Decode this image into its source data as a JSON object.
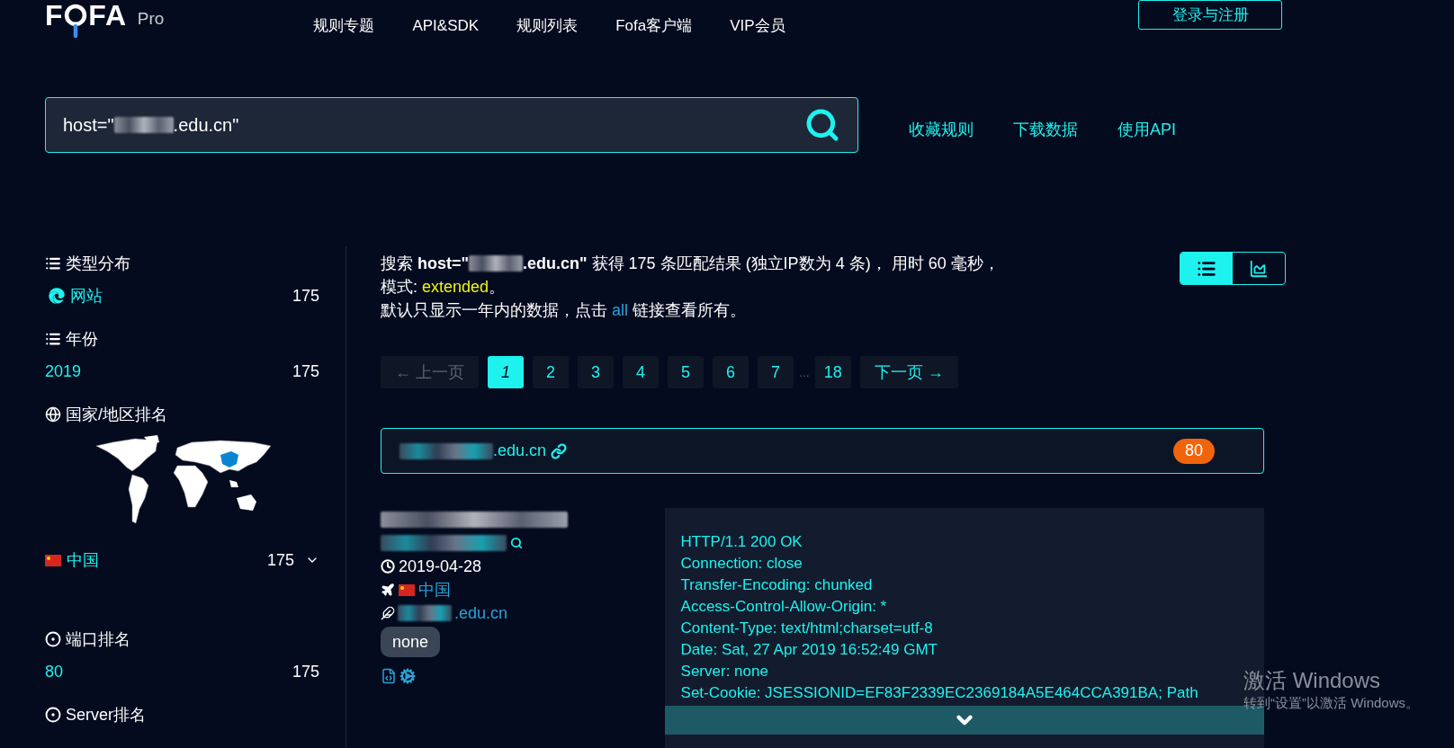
{
  "logo": {
    "letter_start": "F",
    "letter_end": "FA",
    "suffix": "Pro"
  },
  "nav": [
    {
      "label": "规则专题"
    },
    {
      "label": "API&SDK"
    },
    {
      "label": "规则列表"
    },
    {
      "label": "Fofa客户端"
    },
    {
      "label": "VIP会员"
    }
  ],
  "login_button": "登录与注册",
  "search": {
    "value_start": "host=\"",
    "value_end": ".edu.cn\""
  },
  "search_links": [
    "收藏规则",
    "下载数据",
    "使用API"
  ],
  "sidebar": [
    {
      "kind": "category",
      "title": "类型分布",
      "items": [
        {
          "label": "网站",
          "count": "175"
        }
      ]
    },
    {
      "kind": "year",
      "title": "年份",
      "items": [
        {
          "label": "2019",
          "count": "175"
        }
      ]
    },
    {
      "kind": "country",
      "title": "国家/地区排名",
      "items": [
        {
          "label": "中国",
          "count": "175",
          "expanded": false
        }
      ]
    },
    {
      "kind": "port",
      "title": "端口排名",
      "items": [
        {
          "label": "80",
          "count": "175"
        }
      ]
    },
    {
      "kind": "server",
      "title": "Server排名"
    }
  ],
  "summary": {
    "label": "搜索",
    "query_start": "host=\"",
    "query_end": ".edu.cn\"",
    "result": "获得 175 条匹配结果 (独立IP数为 4 条)， 用时 60 毫秒，",
    "mode_label": "模式:",
    "mode": "extended",
    "mode_end": "。",
    "notice_before": "默认只显示一年内的数据，点击",
    "notice_link": "all",
    "notice_after": "链接查看所有。"
  },
  "view_toggle": [
    {
      "kind": "list",
      "selected": true
    },
    {
      "kind": "chart",
      "selected": false
    }
  ],
  "pagination": [
    {
      "kind": "prev",
      "label": "← 上一页",
      "selected": false,
      "disabled": true
    },
    {
      "kind": "page",
      "label": "1",
      "selected": true,
      "disabled": false
    },
    {
      "kind": "page",
      "label": "2",
      "selected": false,
      "disabled": false
    },
    {
      "kind": "page",
      "label": "3",
      "selected": false,
      "disabled": false
    },
    {
      "kind": "page",
      "label": "4",
      "selected": false,
      "disabled": false
    },
    {
      "kind": "page",
      "label": "5",
      "selected": false,
      "disabled": false
    },
    {
      "kind": "page",
      "label": "6",
      "selected": false,
      "disabled": false
    },
    {
      "kind": "page",
      "label": "7",
      "selected": false,
      "disabled": false
    },
    {
      "kind": "page",
      "label": "18",
      "selected": false,
      "disabled": false
    },
    {
      "kind": "next",
      "label": "下一页 →",
      "selected": false,
      "disabled": false
    }
  ],
  "pagination_gap": "...",
  "result": {
    "host_end": ".edu.cn",
    "port": "80",
    "date": "2019-04-28",
    "country": "中国",
    "domain_end": ".edu.cn",
    "tag": "none",
    "response": [
      "HTTP/1.1 200 OK",
      "Connection: close",
      "Transfer-Encoding: chunked",
      "Access-Control-Allow-Origin: *",
      "Content-Type: text/html;charset=utf-8",
      "Date: Sat, 27 Apr 2019 16:52:49 GMT",
      "Server: none",
      "Set-Cookie: JSESSIONID=EF83F2339EC2369184A5E464CCA391BA; Path"
    ]
  },
  "os_notice": {
    "title": "激活 Windows",
    "subtitle": "转到“设置”以激活 Windows。"
  }
}
